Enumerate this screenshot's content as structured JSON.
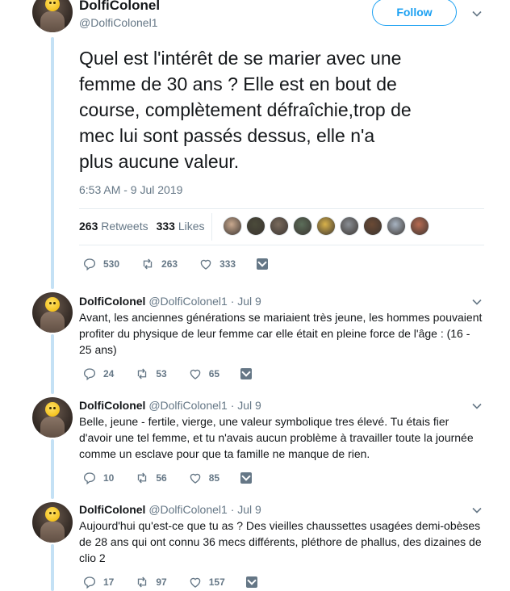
{
  "main_tweet": {
    "display_name": "DolfiColonel",
    "handle": "@DolfiColonel1",
    "follow_label": "Follow",
    "text": "Quel est l'intérêt de se marier avec une\nfemme de 30 ans ? Elle est en bout de\ncourse, complètement défraîchie,trop de\nmec lui sont passés dessus, elle n'a\nplus aucune valeur.",
    "timestamp": "6:53 AM - 9 Jul 2019",
    "retweets_count": "263",
    "retweets_label": "Retweets",
    "likes_count": "333",
    "likes_label": "Likes",
    "likers": [
      "#c9a98f",
      "#4b4b3a",
      "#7a6b5d",
      "#5c6e5a",
      "#d9b24a",
      "#8a8f95",
      "#6b4a35",
      "#a8b4c2",
      "#b86b52"
    ],
    "actions": {
      "replies": "530",
      "retweets": "263",
      "likes": "333"
    }
  },
  "replies": [
    {
      "display_name": "DolfiColonel",
      "handle": "@DolfiColonel1",
      "date": "· Jul 9",
      "text": "Avant, les anciennes générations se mariaient très jeune, les hommes pouvaient profiter du physique de leur femme car elle était en pleine force de l'âge : (16 - 25 ans)",
      "actions": {
        "replies": "24",
        "retweets": "53",
        "likes": "65"
      }
    },
    {
      "display_name": "DolfiColonel",
      "handle": "@DolfiColonel1",
      "date": "· Jul 9",
      "text": "Belle, jeune - fertile, vierge, une valeur symbolique tres élevé. Tu étais fier d'avoir une tel femme, et tu n'avais aucun problème à travailler toute la journée comme un esclave pour que ta famille ne manque de rien.",
      "actions": {
        "replies": "10",
        "retweets": "56",
        "likes": "85"
      }
    },
    {
      "display_name": "DolfiColonel",
      "handle": "@DolfiColonel1",
      "date": "· Jul 9",
      "text": "Aujourd'hui qu'est-ce que tu as ? Des vieilles chaussettes usagées demi-obèses de 28 ans qui ont connu 36 mecs différents, pléthore de phallus, des dizaines de clio 2",
      "actions": {
        "replies": "17",
        "retweets": "97",
        "likes": "157"
      }
    }
  ],
  "colors": {
    "accent": "#1da1f2",
    "thread_line": "#c4e1f5",
    "muted": "#657786"
  }
}
